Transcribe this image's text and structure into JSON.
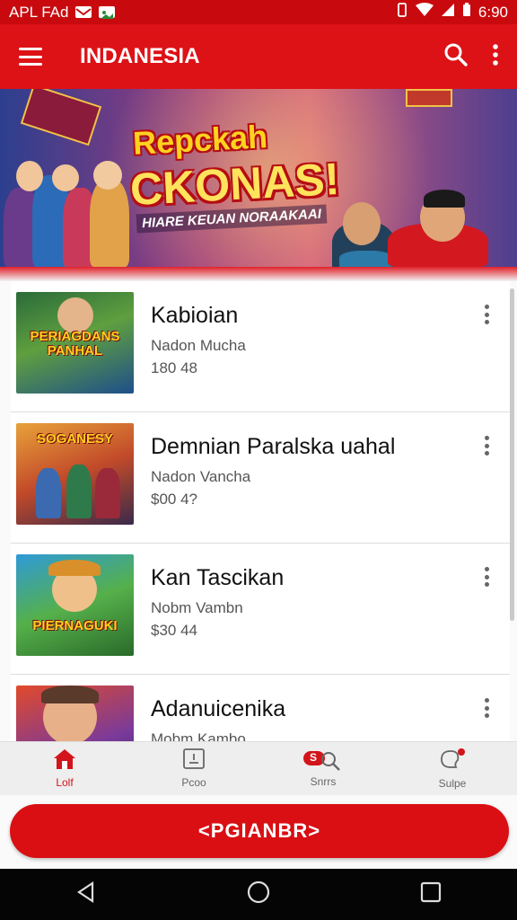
{
  "status_bar": {
    "left_text": "APL FAd",
    "time": "6:90"
  },
  "app_bar": {
    "title": "INDANESIA",
    "icons": [
      "menu-icon",
      "search-icon",
      "more-vert-icon"
    ]
  },
  "banner": {
    "headline_line1": "Repckah",
    "headline_line2": "CKONAS!",
    "subline": "HIARE KEUAN NORAAKAAI"
  },
  "games": [
    {
      "title": "Kabioian",
      "subtitle": "Nadon Mucha",
      "price": "180 48",
      "thumb_text": "PERIAGDANS PANHAL"
    },
    {
      "title": "Demnian Paralska uahal",
      "subtitle": "Nadon Vancha",
      "price": "$00 4?",
      "thumb_text": "SOGANESY"
    },
    {
      "title": "Kan Tascikan",
      "subtitle": "Nobm Vambn",
      "price": "$30 44",
      "thumb_text": "PIERNAGUKI"
    },
    {
      "title": "Adanuicenika",
      "subtitle": "Mobm Kambo",
      "price": "",
      "thumb_text": ""
    }
  ],
  "bottom_nav": [
    {
      "label": "Lolf",
      "icon": "home-icon",
      "active": true
    },
    {
      "label": "Pcoo",
      "icon": "tablet-icon",
      "active": false
    },
    {
      "label": "Snrrs",
      "icon": "search-icon",
      "badge": "S",
      "active": false
    },
    {
      "label": "Sulpe",
      "icon": "support-icon",
      "badge": "",
      "active": false
    }
  ],
  "cta": {
    "label": "<PGIANBR>"
  },
  "colors": {
    "primary": "#dd1217",
    "status": "#c80a0f",
    "accent_yellow": "#ffd21f"
  }
}
